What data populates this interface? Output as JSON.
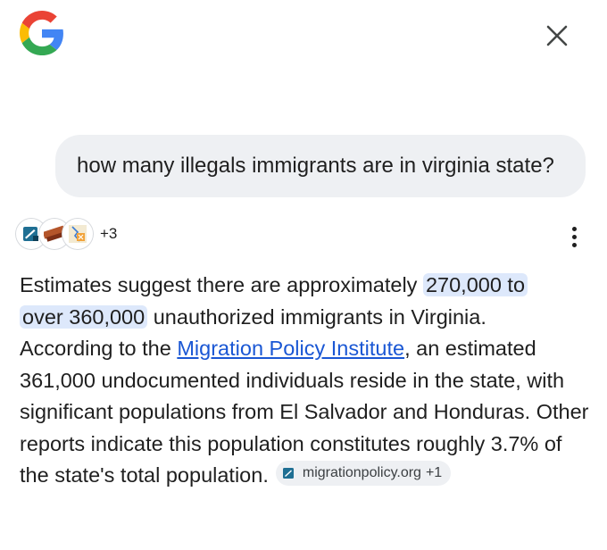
{
  "header": {
    "logo_icon": "google-g-icon",
    "close_icon": "close-icon"
  },
  "query": {
    "text": "how many illegals immigrants are in virginia state?"
  },
  "sources": {
    "favicons": [
      "migrationpolicy-favicon-icon",
      "news-favicon-icon",
      "map-favicon-icon"
    ],
    "more_count": "+3",
    "menu_icon": "more-vert-icon"
  },
  "answer": {
    "p1": "Estimates suggest there are approximately ",
    "highlight_a": "270,000 to",
    "highlight_b": "over 360,000",
    "p2": " unauthorized immigrants in Virginia.",
    "p3": "According to the ",
    "link_text": "Migration Policy Institute",
    "p4": ", an estimated 361,000 undocumented individuals reside in the state, with significant populations from El Salvador and Honduras. Other reports indicate this population constitutes roughly 3.7% of the state's total population.",
    "citation": {
      "icon": "migrationpolicy-favicon-icon",
      "domain": "migrationpolicy.org",
      "extra": "+1"
    }
  },
  "colors": {
    "bubble_bg": "#eef0f3",
    "highlight_bg": "#dde8fb",
    "link": "#1a57d4",
    "text": "#1f1f1f"
  }
}
